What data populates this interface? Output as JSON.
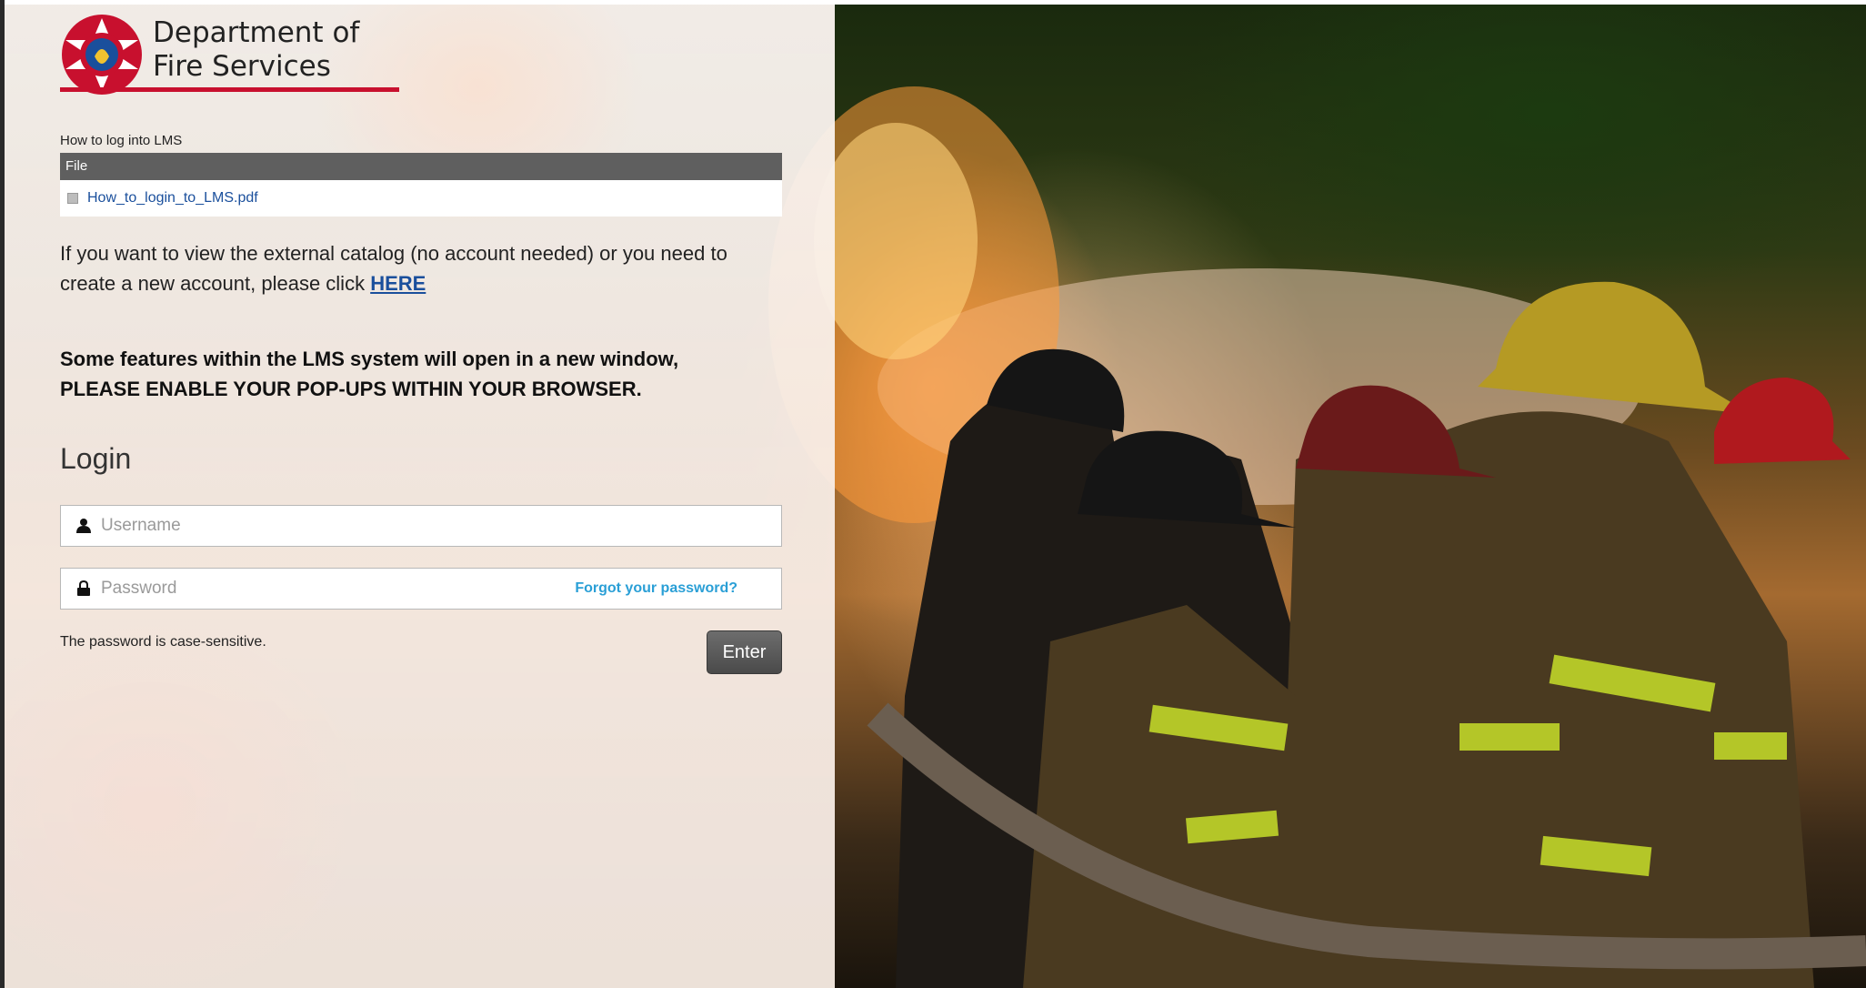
{
  "brand": {
    "line1": "Department of",
    "line2": "Fire Services",
    "accent_color": "#c8102e"
  },
  "documents": {
    "caption": "How to log into LMS",
    "header": "File",
    "files": [
      {
        "name": "How_to_login_to_LMS.pdf",
        "icon": "file-icon"
      }
    ]
  },
  "catalog": {
    "text": "If you want to view the external catalog (no account needed) or you need to create a new account, please click ",
    "link_label": "HERE"
  },
  "popup_notice": {
    "line1": "Some features within the LMS system will open in a new window,",
    "line2": "PLEASE ENABLE YOUR POP-UPS WITHIN YOUR BROWSER."
  },
  "login": {
    "title": "Login",
    "username": {
      "placeholder": "Username",
      "value": "",
      "icon": "user-icon"
    },
    "password": {
      "placeholder": "Password",
      "value": "",
      "icon": "lock-icon"
    },
    "forgot_label": "Forgot your password?",
    "case_note": "The password is case-sensitive.",
    "submit_label": "Enter"
  },
  "colors": {
    "link": "#1a4f9c",
    "forgot_link": "#2a9fd6",
    "button": "#555555",
    "table_header": "#5f5f5f"
  }
}
